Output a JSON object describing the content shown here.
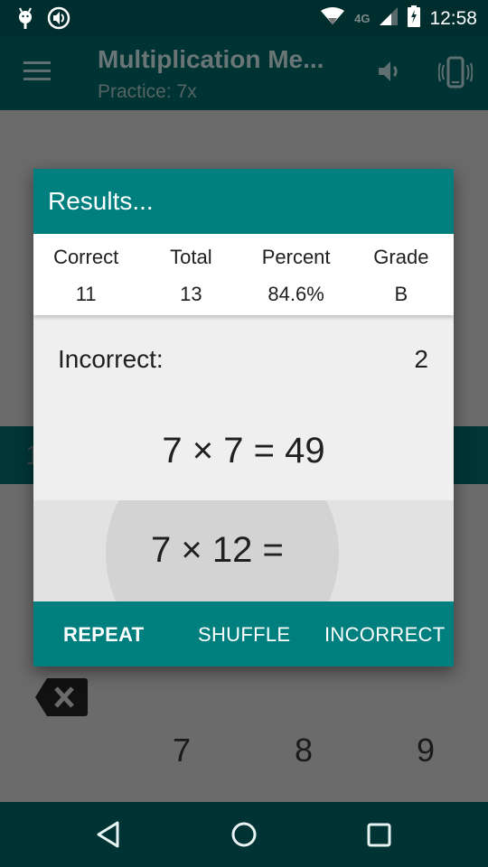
{
  "status_bar": {
    "time": "12:58",
    "left_icons": [
      "android-debug-icon",
      "volume-notification-icon"
    ],
    "right_icons": [
      "wifi-icon",
      "lte-data-icon",
      "cell-signal-icon",
      "battery-charging-icon"
    ],
    "network_label": "4G"
  },
  "app_bar": {
    "title": "Multiplication Me...",
    "subtitle": "Practice: 7x",
    "icons": [
      "menu-icon",
      "volume-icon",
      "vibrate-icon"
    ]
  },
  "background": {
    "band_text": "1",
    "keypad_keys": [
      "7",
      "8",
      "9"
    ]
  },
  "dialog": {
    "title": "Results...",
    "stats": [
      {
        "label": "Correct",
        "value": "11"
      },
      {
        "label": "Total",
        "value": "13"
      },
      {
        "label": "Percent",
        "value": "84.6%"
      },
      {
        "label": "Grade",
        "value": "B"
      }
    ],
    "incorrect_label": "Incorrect:",
    "incorrect_count": "2",
    "answered_problem": "7 × 7 = 49",
    "current_problem": "7 × 12 =",
    "actions": {
      "repeat": "REPEAT",
      "shuffle": "SHUFFLE",
      "incorrect": "INCORRECT"
    }
  },
  "colors": {
    "accent": "#007f7f",
    "dark_primary": "#003333",
    "scrim": "#6b6b6b"
  }
}
